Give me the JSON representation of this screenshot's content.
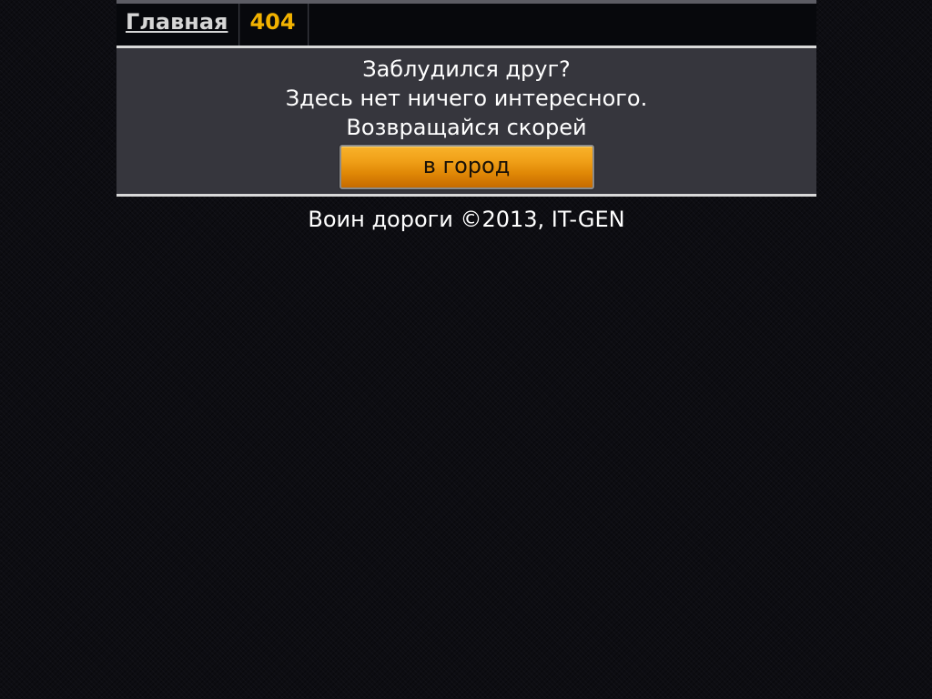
{
  "nav": {
    "home_label": "Главная",
    "current_label": "404"
  },
  "message": {
    "line1": "Заблудился друг?",
    "line2": "Здесь нет ничего интересного.",
    "line3": "Возвращайся скорей"
  },
  "button": {
    "label": "в город"
  },
  "footer": {
    "text": "Воин дороги ©2013, IT-GEN"
  },
  "colors": {
    "accent": "#f2b200",
    "button": "#f0a018",
    "panel": "#36363d"
  }
}
